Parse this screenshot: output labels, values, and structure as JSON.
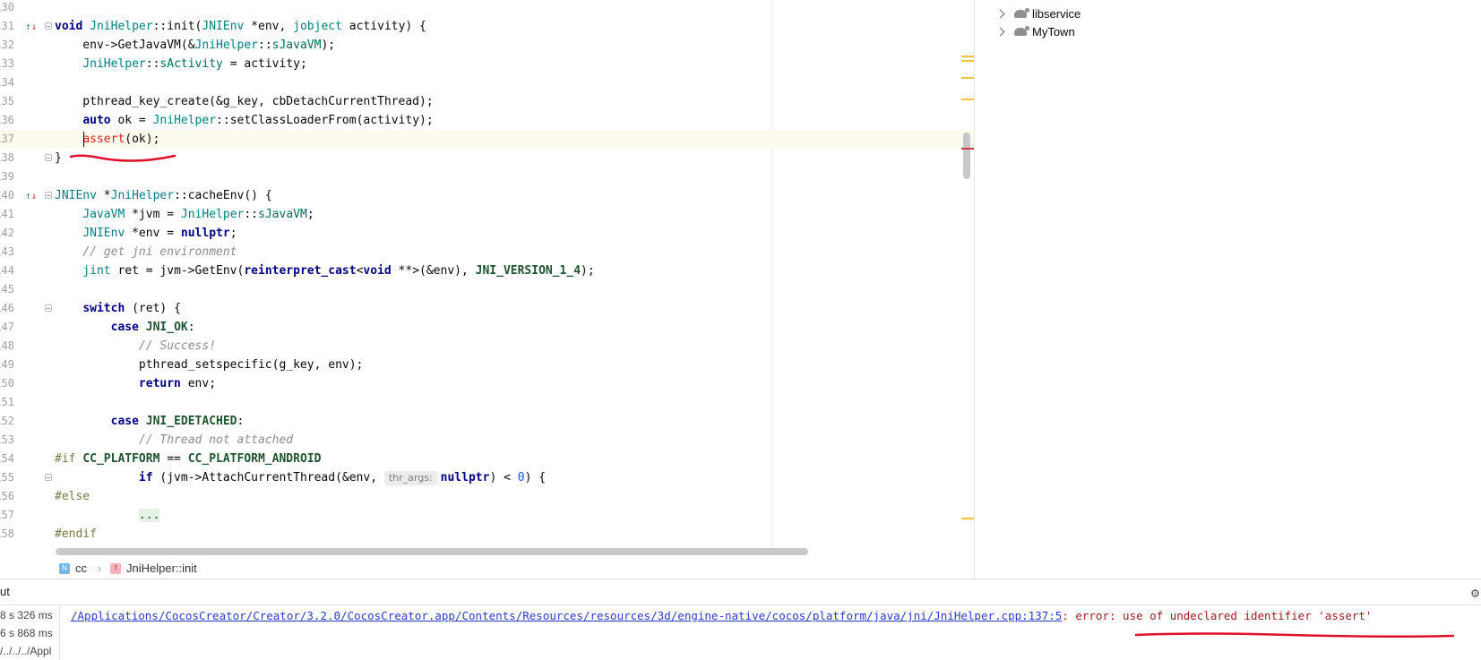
{
  "editor": {
    "lines": [
      {
        "num": "130"
      },
      {
        "num": "131"
      },
      {
        "num": "132"
      },
      {
        "num": "133"
      },
      {
        "num": "134"
      },
      {
        "num": "135"
      },
      {
        "num": "136"
      },
      {
        "num": "137"
      },
      {
        "num": "138"
      },
      {
        "num": "139"
      },
      {
        "num": "140"
      },
      {
        "num": "141"
      },
      {
        "num": "142"
      },
      {
        "num": "143"
      },
      {
        "num": "144"
      },
      {
        "num": "145"
      },
      {
        "num": "146"
      },
      {
        "num": "147"
      },
      {
        "num": "148"
      },
      {
        "num": "149"
      },
      {
        "num": "150"
      },
      {
        "num": "151"
      },
      {
        "num": "152"
      },
      {
        "num": "153"
      },
      {
        "num": "154"
      },
      {
        "num": "155"
      },
      {
        "num": "156"
      },
      {
        "num": "157"
      },
      {
        "num": "158"
      },
      {
        "num": "159"
      }
    ],
    "code": {
      "l131": {
        "void": "void",
        "cls": "JniHelper",
        "fn": "::init(",
        "env_t": "JNIEnv",
        "p1": " *env, ",
        "jobject": "jobject",
        "p2": " activity) {"
      },
      "l132": {
        "a": "    env->GetJavaVM(&",
        "cls": "JniHelper",
        "sep": "::",
        "sv": "sJavaVM",
        "b": ");"
      },
      "l133": {
        "a": "    ",
        "cls": "JniHelper",
        "sep": "::",
        "sv": "sActivity",
        "b": " = activity;"
      },
      "l135": {
        "a": "    pthread_key_create(&g_key, cbDetachCurrentThread);"
      },
      "l136": {
        "a": "    ",
        "auto": "auto",
        "b": " ok = ",
        "cls": "JniHelper",
        "c": "::setClassLoaderFrom(activity);"
      },
      "l137": {
        "a": "    ",
        "assert": "assert",
        "b": "(ok);"
      },
      "l138": {
        "a": "}"
      },
      "l140": {
        "env_t": "JNIEnv",
        "a": " *",
        "cls": "JniHelper",
        "b": "::cacheEnv() {"
      },
      "l141": {
        "a": "    ",
        "vm_t": "JavaVM",
        "b": " *jvm = ",
        "cls": "JniHelper",
        "sep": "::",
        "sv": "sJavaVM",
        "c": ";"
      },
      "l142": {
        "a": "    ",
        "env_t": "JNIEnv",
        "b": " *env = ",
        "nullptr": "nullptr",
        "c": ";"
      },
      "l143": {
        "a": "    ",
        "cm": "// get jni environment"
      },
      "l144": {
        "a": "    ",
        "jint": "jint",
        "b": " ret = jvm->GetEnv(",
        "rc": "reinterpret_cast",
        "c": "<",
        "void": "void",
        "d": " **>(&env), ",
        "mac": "JNI_VERSION_1_4",
        "e": ");"
      },
      "l146": {
        "a": "    ",
        "switch": "switch",
        "b": " (ret) {"
      },
      "l147": {
        "a": "        ",
        "case": "case",
        "b": " ",
        "mac": "JNI_OK",
        "c": ":"
      },
      "l148": {
        "a": "            ",
        "cm": "// Success!"
      },
      "l149": {
        "a": "            pthread_setspecific(g_key, env);"
      },
      "l150": {
        "a": "            ",
        "ret": "return",
        "b": " env;"
      },
      "l152": {
        "a": "        ",
        "case": "case",
        "b": " ",
        "mac": "JNI_EDETACHED",
        "c": ":"
      },
      "l153": {
        "a": "            ",
        "cm": "// Thread not attached"
      },
      "l154": {
        "pp": "#if",
        "b": " ",
        "m1": "CC_PLATFORM",
        "c": " == ",
        "m2": "CC_PLATFORM_ANDROID"
      },
      "l155": {
        "a": "            ",
        "if": "if",
        "b": " (jvm->AttachCurrentThread(&env, ",
        "hint": "thr_args:",
        "nullptr": "nullptr",
        "c": ") < ",
        "zero": "0",
        "d": ") {"
      },
      "l156": {
        "pp": "#else"
      },
      "l157": {
        "a": "            ",
        "fold": "..."
      },
      "l158": {
        "pp": "#endif"
      }
    }
  },
  "breadcrumb": {
    "ns_badge": "N",
    "ns_label": "cc",
    "fn_badge": "f",
    "fn_label": "JniHelper::init"
  },
  "project": {
    "items": [
      {
        "label": "libservice"
      },
      {
        "label": "MyTown"
      }
    ]
  },
  "bottom": {
    "tab_label": "ut",
    "build_rows": [
      "8 s 326 ms",
      "6 s 868 ms",
      "/../../../Appl"
    ],
    "error_link": "/Applications/CocosCreator/Creator/3.2.0/CocosCreator.app/Contents/Resources/resources/3d/engine-native/cocos/platform/java/jni/JniHelper.cpp:137:5",
    "error_text": ": error: use of undeclared identifier 'assert'"
  },
  "colors": {
    "annotation": "#e0102a",
    "warning_mark": "#f2c33b",
    "error_mark": "#d23d3d"
  },
  "icons": {
    "gear": "gear-icon",
    "module": "module-icon",
    "chevron": "chevron-right-icon"
  }
}
